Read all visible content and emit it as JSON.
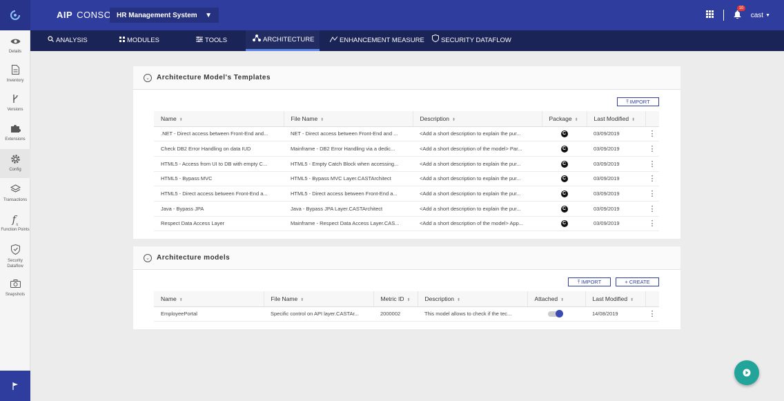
{
  "brand": {
    "bold": "AIP",
    "name": "CONSOLE"
  },
  "app_selector": {
    "value": "HR Management System"
  },
  "header": {
    "notification_count": "10",
    "user": "cast"
  },
  "nav": [
    {
      "label": "ANALYSIS",
      "icon": "search-icon"
    },
    {
      "label": "MODULES",
      "icon": "modules-icon"
    },
    {
      "label": "TOOLS",
      "icon": "tools-icon"
    },
    {
      "label": "ARCHITECTURE",
      "icon": "architecture-icon",
      "active": true
    },
    {
      "label": "ENHANCEMENT MEASURE",
      "icon": "enhancement-icon"
    },
    {
      "label": "SECURITY DATAFLOW",
      "icon": "shield-icon"
    }
  ],
  "sidebar": [
    {
      "label": "Details",
      "icon": "eye-icon"
    },
    {
      "label": "Inventory",
      "icon": "document-icon"
    },
    {
      "label": "Versions",
      "icon": "branch-icon"
    },
    {
      "label": "Extensions",
      "icon": "puzzle-icon"
    },
    {
      "label": "Config",
      "icon": "gear-icon",
      "active": true
    },
    {
      "label": "Transactions",
      "icon": "layers-icon"
    },
    {
      "label": "Function Points",
      "icon": "function-icon"
    },
    {
      "label": "Security Dataflow",
      "icon": "shield-icon"
    },
    {
      "label": "Snapshots",
      "icon": "camera-icon"
    }
  ],
  "templates": {
    "title": "Architecture Model's Templates",
    "import_label": "IMPORT",
    "columns": [
      "Name",
      "File Name",
      "Description",
      "Package",
      "Last Modified"
    ],
    "rows": [
      {
        "name": ".NET - Direct access between Front-End and...",
        "file": "NET - Direct access between Front-End and ...",
        "desc": "<Add a short description to explain the pur...",
        "package": "C",
        "modified": "03/09/2019"
      },
      {
        "name": "Check DB2 Error Handling on data IUD",
        "file": "Mainframe - DB2 Error Handling via a dedic...",
        "desc": "<Add a short description of the model> Par...",
        "package": "C",
        "modified": "03/09/2019"
      },
      {
        "name": "HTML5 - Access from UI to DB with empty C...",
        "file": "HTML5 - Empty Catch Block when accessing...",
        "desc": "<Add a short description to explain the pur...",
        "package": "C",
        "modified": "03/09/2019"
      },
      {
        "name": "HTML5 - Bypass MVC",
        "file": "HTML5 - Bypass MVC Layer.CASTArchitect",
        "desc": "<Add a short description to explain the pur...",
        "package": "C",
        "modified": "03/09/2019"
      },
      {
        "name": "HTML5 - Direct access between Front-End a...",
        "file": "HTML5 - Direct access between Front-End a...",
        "desc": "<Add a short description to explain the pur...",
        "package": "C",
        "modified": "03/09/2019"
      },
      {
        "name": "Java - Bypass JPA",
        "file": "Java - Bypass JPA Layer.CASTArchitect",
        "desc": "<Add a short description to explain the pur...",
        "package": "C",
        "modified": "03/09/2019"
      },
      {
        "name": "Respect Data Access Layer",
        "file": "Mainframe - Respect Data Access Layer.CAS...",
        "desc": "<Add a short description of the model> App...",
        "package": "C",
        "modified": "03/09/2019"
      }
    ]
  },
  "models": {
    "title": "Architecture models",
    "import_label": "IMPORT",
    "create_label": "CREATE",
    "columns": [
      "Name",
      "File Name",
      "Metric ID",
      "Description",
      "Attached",
      "Last Modified"
    ],
    "rows": [
      {
        "name": "EmployeePortal",
        "file": "Specific control on API layer.CASTAr...",
        "metric": "2000002",
        "desc": "This model allows to check if the tec...",
        "attached": true,
        "modified": "14/08/2019"
      }
    ]
  },
  "colors": {
    "topbar": "#2f3e9e",
    "nav": "#1b2456",
    "accent": "#3b4bb4",
    "play": "#23a49b"
  }
}
